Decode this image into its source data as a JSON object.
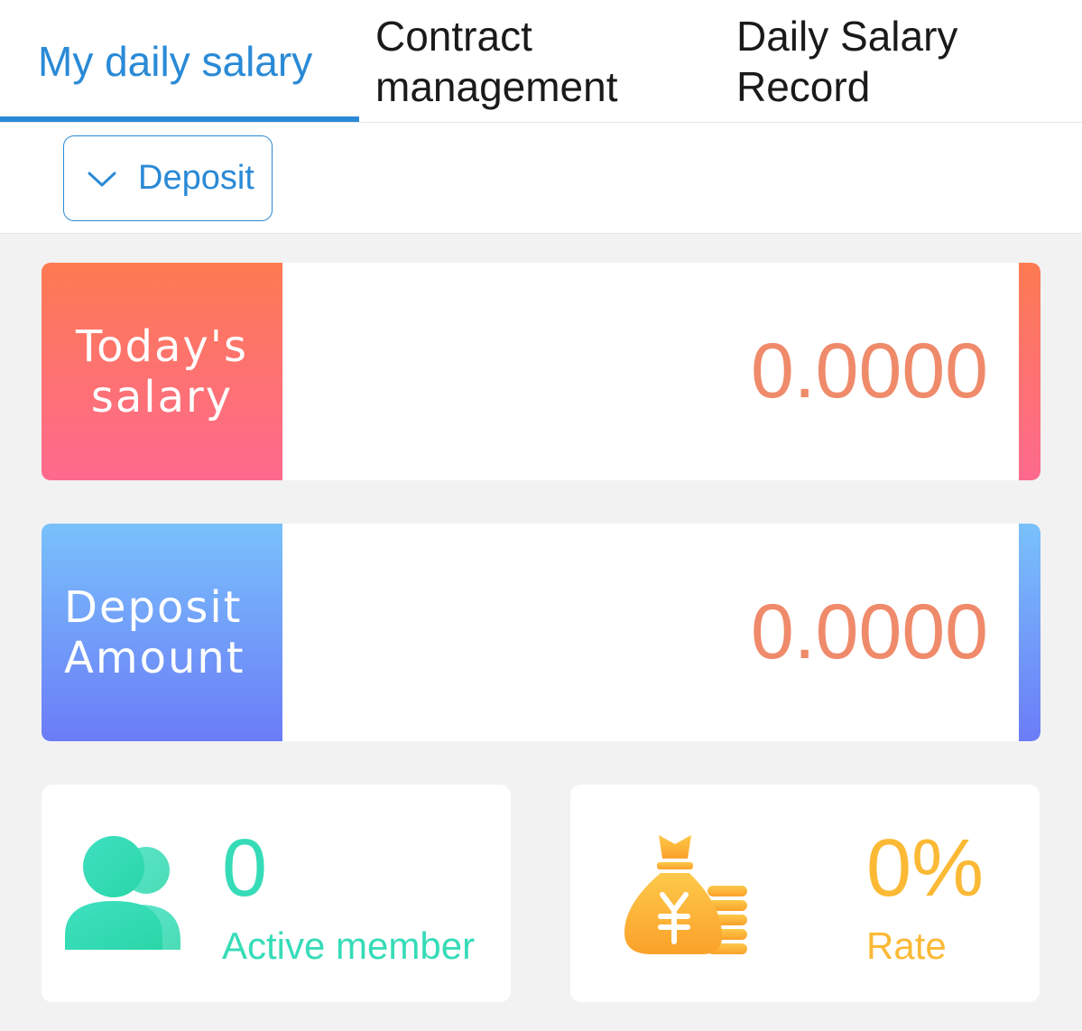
{
  "tabs": [
    {
      "label": "My daily salary",
      "active": true
    },
    {
      "label": "Contract management",
      "active": false
    },
    {
      "label": "Daily Salary Record",
      "active": false
    }
  ],
  "filter": {
    "selected": "Deposit",
    "icon": "chevron-down-icon"
  },
  "stats": {
    "today_salary": {
      "label": "Today's salary",
      "value": "0.0000"
    },
    "deposit_amount": {
      "label": "Deposit Amount",
      "value": "0.0000"
    }
  },
  "active_member": {
    "value": "0",
    "label": "Active member",
    "icon": "members-icon"
  },
  "rate": {
    "value": "0%",
    "label": "Rate",
    "icon": "money-bag-icon"
  },
  "colors": {
    "accent": "#2a8ad6",
    "salary_gradient_start": "#fd7a52",
    "salary_gradient_end": "#fd6a8e",
    "deposit_gradient_start": "#79c1fb",
    "deposit_gradient_end": "#6b7cf7",
    "value": "#ef8a6a",
    "member": "#36dcb7",
    "rate": "#fbb935"
  }
}
